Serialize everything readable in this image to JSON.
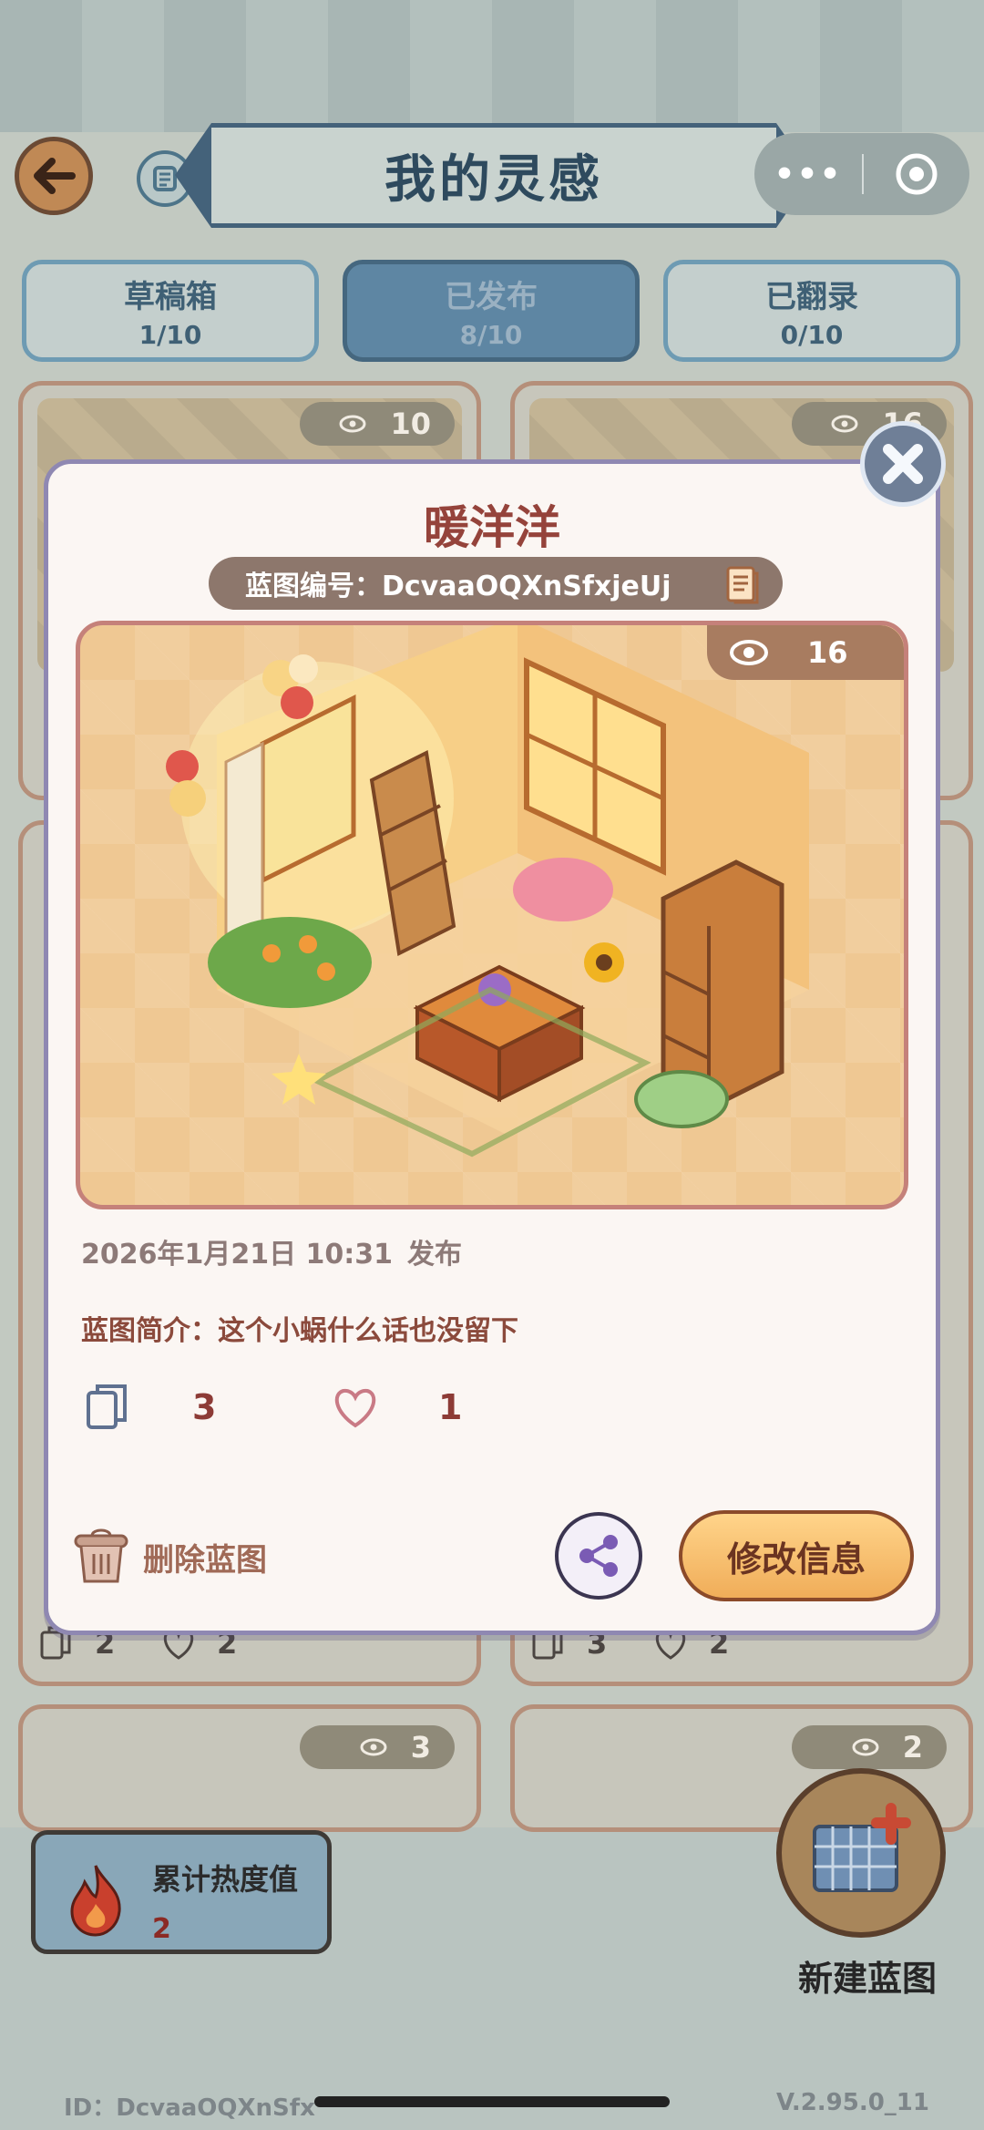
{
  "header": {
    "title": "我的灵感",
    "more_label": "•••"
  },
  "tabs": [
    {
      "label": "草稿箱",
      "count": "1/10",
      "active": false
    },
    {
      "label": "已发布",
      "count": "8/10",
      "active": true
    },
    {
      "label": "已翻录",
      "count": "0/10",
      "active": false
    }
  ],
  "background_cards": [
    {
      "views": "10"
    },
    {
      "views": "16",
      "copies": "3",
      "likes": "2"
    },
    {
      "copies": "2",
      "likes": "2"
    },
    {
      "views": "3"
    },
    {
      "views": "2"
    }
  ],
  "heat": {
    "label": "累计热度值",
    "value": "2"
  },
  "new_blueprint": {
    "label": "新建蓝图"
  },
  "footer": {
    "id_text": "ID：DcvaaOQXnSfx",
    "version": "V.2.95.0_11"
  },
  "modal": {
    "title": "暖洋洋",
    "blueprint_id": "蓝图编号：DcvaaOQXnSfxjeUj",
    "views": "16",
    "date": "2026年1月21日 10:31",
    "status": "发布",
    "description": "蓝图简介：这个小蜗什么话也没留下",
    "copies": "3",
    "likes": "1",
    "delete_label": "删除蓝图",
    "edit_label": "修改信息"
  },
  "colors": {
    "modal_title": "#95433b",
    "edit_button": "#f0ad59",
    "active_tab": "#5e86a3",
    "modal_border": "#8f88b2"
  }
}
